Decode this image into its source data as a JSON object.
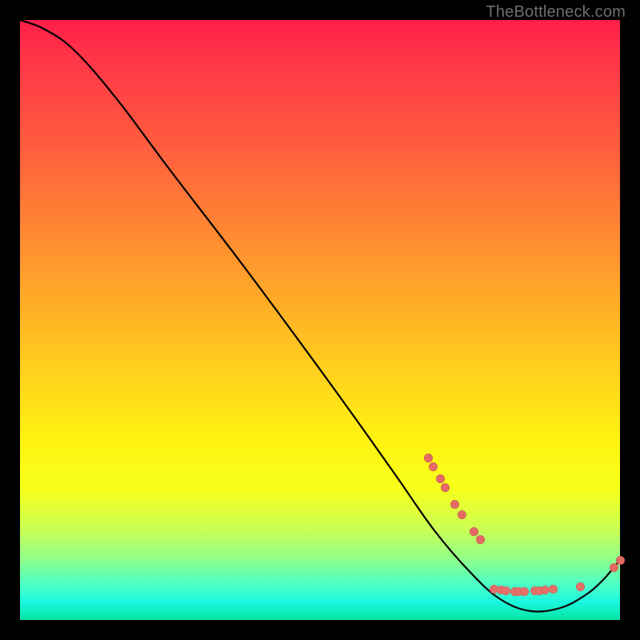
{
  "watermark": "TheBottleneck.com",
  "colors": {
    "dot": "#e46a63",
    "curve": "#000000"
  },
  "chart_data": {
    "type": "line",
    "title": "",
    "xlabel": "",
    "ylabel": "",
    "xlim": [
      0,
      100
    ],
    "ylim": [
      0,
      100
    ],
    "grid": false,
    "legend": false,
    "curve": [
      {
        "x": 0,
        "y": 100
      },
      {
        "x": 4,
        "y": 98.5
      },
      {
        "x": 9,
        "y": 95
      },
      {
        "x": 16,
        "y": 87
      },
      {
        "x": 25,
        "y": 75
      },
      {
        "x": 38,
        "y": 58
      },
      {
        "x": 52,
        "y": 39
      },
      {
        "x": 62,
        "y": 25
      },
      {
        "x": 69,
        "y": 15
      },
      {
        "x": 75,
        "y": 8
      },
      {
        "x": 80,
        "y": 3.5
      },
      {
        "x": 85,
        "y": 1.5
      },
      {
        "x": 90,
        "y": 2
      },
      {
        "x": 94,
        "y": 4
      },
      {
        "x": 97,
        "y": 6.5
      },
      {
        "x": 100,
        "y": 10
      }
    ],
    "cluster_points": [
      {
        "x": 68.0,
        "y": 27.0
      },
      {
        "x": 68.8,
        "y": 25.6
      },
      {
        "x": 70.0,
        "y": 23.5
      },
      {
        "x": 70.8,
        "y": 22.1
      },
      {
        "x": 72.5,
        "y": 19.3
      },
      {
        "x": 73.7,
        "y": 17.5
      },
      {
        "x": 75.6,
        "y": 14.8
      },
      {
        "x": 76.7,
        "y": 13.4
      },
      {
        "x": 79.0,
        "y": 5.2
      },
      {
        "x": 80.2,
        "y": 5.0
      },
      {
        "x": 81.0,
        "y": 4.9
      },
      {
        "x": 82.4,
        "y": 4.8
      },
      {
        "x": 83.1,
        "y": 4.8
      },
      {
        "x": 84.0,
        "y": 4.8
      },
      {
        "x": 85.8,
        "y": 4.9
      },
      {
        "x": 86.6,
        "y": 4.9
      },
      {
        "x": 87.5,
        "y": 5.0
      },
      {
        "x": 88.8,
        "y": 5.1
      },
      {
        "x": 93.4,
        "y": 5.6
      },
      {
        "x": 99.0,
        "y": 8.8
      },
      {
        "x": 100.0,
        "y": 10.0
      }
    ]
  }
}
